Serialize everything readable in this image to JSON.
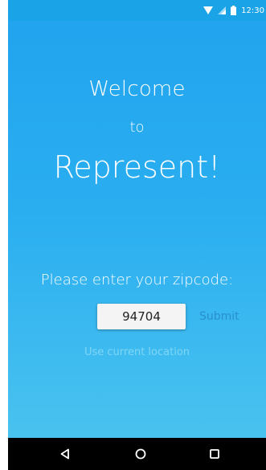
{
  "status_bar": {
    "time": "12:30",
    "icons": [
      "wifi-icon",
      "cellular-signal-icon",
      "battery-icon"
    ]
  },
  "main": {
    "welcome": "Welcome",
    "to": "to",
    "app_name": "Represent!",
    "prompt": "Please enter your zipcode:",
    "zip_value": "94704",
    "submit_label": "Submit",
    "use_location_label": "Use current location"
  },
  "nav_bar": {
    "buttons": [
      "back-icon",
      "home-icon",
      "recent-apps-icon"
    ]
  },
  "colors": {
    "status_bar": "#1aa3e6",
    "background_top": "#22a4ee",
    "background_bottom": "#49c2ef",
    "submit": "#2a8fd0",
    "use_location": "#7fd6f5"
  }
}
